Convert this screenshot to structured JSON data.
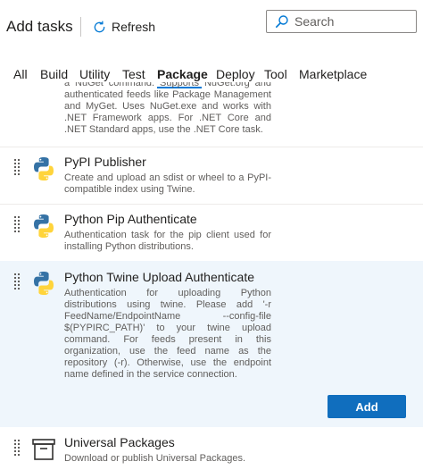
{
  "header": {
    "title": "Add tasks",
    "refresh_label": "Refresh",
    "search_placeholder": "Search"
  },
  "tabs": [
    {
      "label": "All",
      "active": false
    },
    {
      "label": "Build",
      "active": false
    },
    {
      "label": "Utility",
      "active": false
    },
    {
      "label": "Test",
      "active": false
    },
    {
      "label": "Package",
      "active": true
    },
    {
      "label": "Deploy",
      "active": false
    },
    {
      "label": "Tool",
      "active": false
    },
    {
      "label": "Marketplace",
      "active": false
    }
  ],
  "tasks": {
    "partial_top": {
      "desc": "a NuGet command. Supports NuGet.org and authenticated feeds like Package Management and MyGet. Uses NuGet.exe and works with .NET Framework apps. For .NET Core and .NET Standard apps, use the .NET Core task."
    },
    "pypi_publisher": {
      "name": "PyPI Publisher",
      "desc": "Create and upload an sdist or wheel to a PyPI-compatible index using Twine.",
      "icon": "python-icon"
    },
    "pip_authenticate": {
      "name": "Python Pip Authenticate",
      "desc": "Authentication task for the pip client used for installing Python distributions.",
      "icon": "python-icon"
    },
    "twine_authenticate": {
      "name": "Python Twine Upload Authenticate",
      "desc": "Authentication for uploading Python distributions using twine. Please add '-r FeedName/EndpointName --config-file $(PYPIRC_PATH)' to your twine upload command. For feeds present in this organization, use the feed name as the repository (-r). Otherwise, use the endpoint name defined in the service connection.",
      "icon": "python-icon",
      "add_label": "Add",
      "selected": true
    },
    "universal_packages": {
      "name": "Universal Packages",
      "desc": "Download or publish Universal Packages.",
      "icon": "package-box-icon"
    }
  },
  "colors": {
    "accent": "#0078d4",
    "button": "#106ebe",
    "selected_bg": "#eff6fc",
    "python_blue": "#3572a5",
    "python_yellow": "#ffd43b"
  }
}
